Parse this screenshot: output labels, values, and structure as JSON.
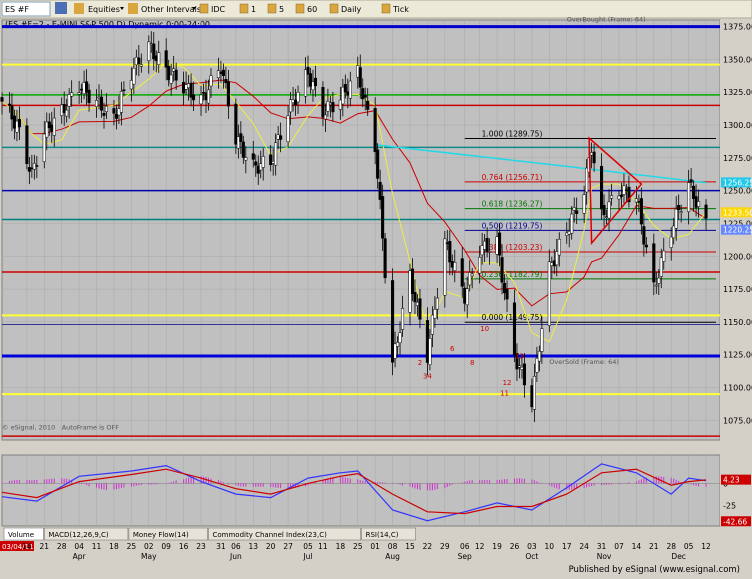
{
  "toolbar": {
    "symbol_box": "ES #F",
    "equities_label": "Equities",
    "other_intervals_label": "Other Intervals",
    "intervals": [
      "IDC",
      "1",
      "5",
      "60",
      "Daily",
      "Tick"
    ]
  },
  "chart_data": [
    {
      "type": "candlestick",
      "title": "(ES #F=2 - E-MINI S&P 500,D) Dynamic 0:00-24:00",
      "ylim": [
        1060,
        1380
      ],
      "yticks": [
        1075,
        1100,
        1125,
        1150,
        1175,
        1200,
        1225,
        1250,
        1275,
        1300,
        1325,
        1350,
        1375
      ],
      "last_price_labels": [
        {
          "text": "1256.25",
          "value": 1256.25,
          "color": "#22c8e8"
        },
        {
          "text": "1233.50",
          "value": 1233.5,
          "color": "#ffd700"
        },
        {
          "text": "1220.25",
          "value": 1220.25,
          "color": "#6688ff"
        }
      ],
      "x_dates": [
        {
          "date": "2011-03-14",
          "label": "14"
        },
        {
          "date": "2011-03-21",
          "label": "21"
        },
        {
          "date": "2011-03-28",
          "label": "28"
        },
        {
          "date": "2011-04-04",
          "label": "04"
        },
        {
          "date": "2011-04-11",
          "label": "11"
        },
        {
          "date": "2011-04-18",
          "label": "18"
        },
        {
          "date": "2011-04-25",
          "label": "25"
        },
        {
          "date": "2011-05-02",
          "label": "02"
        },
        {
          "date": "2011-05-09",
          "label": "09"
        },
        {
          "date": "2011-05-16",
          "label": "16"
        },
        {
          "date": "2011-05-23",
          "label": "23"
        },
        {
          "date": "2011-05-31",
          "label": "31"
        },
        {
          "date": "2011-06-06",
          "label": "06"
        },
        {
          "date": "2011-06-13",
          "label": "13"
        },
        {
          "date": "2011-06-20",
          "label": "20"
        },
        {
          "date": "2011-06-27",
          "label": "27"
        },
        {
          "date": "2011-07-05",
          "label": "05"
        },
        {
          "date": "2011-07-11",
          "label": "11"
        },
        {
          "date": "2011-07-18",
          "label": "18"
        },
        {
          "date": "2011-07-25",
          "label": "25"
        },
        {
          "date": "2011-08-01",
          "label": "01"
        },
        {
          "date": "2011-08-08",
          "label": "08"
        },
        {
          "date": "2011-08-15",
          "label": "15"
        },
        {
          "date": "2011-08-22",
          "label": "22"
        },
        {
          "date": "2011-08-29",
          "label": "29"
        },
        {
          "date": "2011-09-06",
          "label": "06"
        },
        {
          "date": "2011-09-12",
          "label": "12"
        },
        {
          "date": "2011-09-19",
          "label": "19"
        },
        {
          "date": "2011-09-26",
          "label": "26"
        },
        {
          "date": "2011-10-03",
          "label": "03"
        },
        {
          "date": "2011-10-10",
          "label": "10"
        },
        {
          "date": "2011-10-17",
          "label": "17"
        },
        {
          "date": "2011-10-24",
          "label": "24"
        },
        {
          "date": "2011-10-31",
          "label": "31"
        },
        {
          "date": "2011-11-07",
          "label": "07"
        },
        {
          "date": "2011-11-14",
          "label": "14"
        },
        {
          "date": "2011-11-21",
          "label": "21"
        },
        {
          "date": "2011-11-28",
          "label": "28"
        },
        {
          "date": "2011-12-05",
          "label": "05"
        },
        {
          "date": "2011-12-12",
          "label": "12"
        }
      ],
      "first_date_label": "03/04/11",
      "month_labels": [
        {
          "date": "2011-04-04",
          "label": "Apr"
        },
        {
          "date": "2011-05-02",
          "label": "May"
        },
        {
          "date": "2011-06-06",
          "label": "Jun"
        },
        {
          "date": "2011-07-05",
          "label": "Jul"
        },
        {
          "date": "2011-08-08",
          "label": "Aug"
        },
        {
          "date": "2011-09-06",
          "label": "Sep"
        },
        {
          "date": "2011-10-03",
          "label": "Oct"
        },
        {
          "date": "2011-11-01",
          "label": "Nov"
        },
        {
          "date": "2011-12-01",
          "label": "Dec"
        }
      ],
      "close_path": [
        {
          "date": "2011-03-04",
          "value": 1318
        },
        {
          "date": "2011-03-10",
          "value": 1300
        },
        {
          "date": "2011-03-16",
          "value": 1262
        },
        {
          "date": "2011-03-21",
          "value": 1294
        },
        {
          "date": "2011-03-28",
          "value": 1310
        },
        {
          "date": "2011-04-04",
          "value": 1330
        },
        {
          "date": "2011-04-18",
          "value": 1305
        },
        {
          "date": "2011-04-25",
          "value": 1340
        },
        {
          "date": "2011-05-02",
          "value": 1360
        },
        {
          "date": "2011-05-09",
          "value": 1342
        },
        {
          "date": "2011-05-16",
          "value": 1330
        },
        {
          "date": "2011-05-23",
          "value": 1318
        },
        {
          "date": "2011-05-31",
          "value": 1345
        },
        {
          "date": "2011-06-06",
          "value": 1290
        },
        {
          "date": "2011-06-13",
          "value": 1268
        },
        {
          "date": "2011-06-20",
          "value": 1272
        },
        {
          "date": "2011-06-27",
          "value": 1310
        },
        {
          "date": "2011-07-05",
          "value": 1340
        },
        {
          "date": "2011-07-11",
          "value": 1310
        },
        {
          "date": "2011-07-18",
          "value": 1320
        },
        {
          "date": "2011-07-25",
          "value": 1340
        },
        {
          "date": "2011-08-01",
          "value": 1285
        },
        {
          "date": "2011-08-08",
          "value": 1118
        },
        {
          "date": "2011-08-15",
          "value": 1185
        },
        {
          "date": "2011-08-22",
          "value": 1125
        },
        {
          "date": "2011-08-29",
          "value": 1210
        },
        {
          "date": "2011-09-06",
          "value": 1170
        },
        {
          "date": "2011-09-12",
          "value": 1205
        },
        {
          "date": "2011-09-19",
          "value": 1210
        },
        {
          "date": "2011-09-26",
          "value": 1125
        },
        {
          "date": "2011-10-03",
          "value": 1090
        },
        {
          "date": "2011-10-10",
          "value": 1190
        },
        {
          "date": "2011-10-17",
          "value": 1220
        },
        {
          "date": "2011-10-24",
          "value": 1250
        },
        {
          "date": "2011-10-27",
          "value": 1285
        },
        {
          "date": "2011-10-31",
          "value": 1230
        },
        {
          "date": "2011-11-07",
          "value": 1250
        },
        {
          "date": "2011-11-14",
          "value": 1245
        },
        {
          "date": "2011-11-21",
          "value": 1175
        },
        {
          "date": "2011-11-28",
          "value": 1220
        },
        {
          "date": "2011-12-05",
          "value": 1255
        },
        {
          "date": "2011-12-12",
          "value": 1225
        }
      ],
      "horizontal_lines": [
        {
          "value": 1375,
          "color": "#0000cc",
          "width": 3
        },
        {
          "value": 1346,
          "color": "#ffff33",
          "width": 2
        },
        {
          "value": 1323,
          "color": "#00aa00",
          "width": 1.5
        },
        {
          "value": 1315,
          "color": "#cc0000",
          "width": 1.5
        },
        {
          "value": 1283,
          "color": "#118888",
          "width": 1.5
        },
        {
          "value": 1250,
          "color": "#0000aa",
          "width": 1.5
        },
        {
          "value": 1228,
          "color": "#008080",
          "width": 1.5
        },
        {
          "value": 1188,
          "color": "#cc0000",
          "width": 1.5
        },
        {
          "value": 1155,
          "color": "#ffff33",
          "width": 2
        },
        {
          "value": 1148,
          "color": "#333399",
          "width": 1
        },
        {
          "value": 1124,
          "color": "#0000dd",
          "width": 3
        },
        {
          "value": 1095,
          "color": "#ffff33",
          "width": 2
        },
        {
          "value": 1063,
          "color": "#cc0000",
          "width": 1.5
        }
      ],
      "fib_levels": [
        {
          "label": "1.000 (1289.75)",
          "value": 1289.75,
          "color": "#000000"
        },
        {
          "label": "0.764 (1256.71)",
          "value": 1256.71,
          "color": "#cc0000"
        },
        {
          "label": "0.618 (1236.27)",
          "value": 1236.27,
          "color": "#007700"
        },
        {
          "label": "0.500 (1219.75)",
          "value": 1219.75,
          "color": "#000099"
        },
        {
          "label": "0.382 (1203.23)",
          "value": 1203.23,
          "color": "#cc0000"
        },
        {
          "label": "0.236 (1182.79)",
          "value": 1182.79,
          "color": "#007700"
        },
        {
          "label": "0.000 (1149.75)",
          "value": 1149.75,
          "color": "#000000"
        }
      ],
      "annotations": [
        {
          "text": "OverBought (Frame: 64)",
          "date": "2011-10-17",
          "value": 1379
        },
        {
          "text": "OverSold (Frame: 64)",
          "date": "2011-10-10",
          "value": 1118
        },
        {
          "text": "© eSignal, 2010",
          "date": "2011-03-04",
          "value": 1068
        },
        {
          "text": "AutoFrame is OFF",
          "date": "2011-03-28",
          "value": 1068
        }
      ],
      "count_labels": [
        {
          "text": "34",
          "date": "2011-08-22",
          "value": 1107,
          "color": "#cc0000"
        },
        {
          "text": "2",
          "date": "2011-08-19",
          "value": 1117,
          "color": "#cc0000"
        },
        {
          "text": "8",
          "date": "2011-09-09",
          "value": 1117,
          "color": "#cc0000"
        },
        {
          "text": "6",
          "date": "2011-09-01",
          "value": 1128,
          "color": "#cc0000"
        },
        {
          "text": "10",
          "date": "2011-09-14",
          "value": 1143,
          "color": "#cc0000"
        },
        {
          "text": "12",
          "date": "2011-09-23",
          "value": 1102,
          "color": "#cc0000"
        },
        {
          "text": "11",
          "date": "2011-09-22",
          "value": 1094,
          "color": "#cc0000"
        },
        {
          "text": "13",
          "date": "2011-09-28",
          "value": 1122,
          "color": "#cc0000"
        }
      ]
    },
    {
      "type": "line",
      "title": "",
      "ylim": [
        -48,
        32
      ],
      "yticks": [
        0,
        -25
      ],
      "value_labels": [
        {
          "text": "4.23",
          "value": 4.23,
          "color": "#cc0000"
        },
        {
          "text": "-42.66",
          "value": -42.66,
          "color": "#cc0000"
        }
      ],
      "series": [
        {
          "color": "#3333ff",
          "values": [
            {
              "date": "2011-03-04",
              "value": -15
            },
            {
              "date": "2011-03-18",
              "value": -20
            },
            {
              "date": "2011-04-04",
              "value": 8
            },
            {
              "date": "2011-04-25",
              "value": 14
            },
            {
              "date": "2011-05-09",
              "value": 20
            },
            {
              "date": "2011-05-23",
              "value": 2
            },
            {
              "date": "2011-06-06",
              "value": -12
            },
            {
              "date": "2011-06-20",
              "value": -16
            },
            {
              "date": "2011-07-05",
              "value": 6
            },
            {
              "date": "2011-07-18",
              "value": 12
            },
            {
              "date": "2011-07-25",
              "value": 14
            },
            {
              "date": "2011-08-08",
              "value": -30
            },
            {
              "date": "2011-08-22",
              "value": -42
            },
            {
              "date": "2011-09-06",
              "value": -32
            },
            {
              "date": "2011-09-19",
              "value": -22
            },
            {
              "date": "2011-10-03",
              "value": -30
            },
            {
              "date": "2011-10-17",
              "value": -5
            },
            {
              "date": "2011-10-31",
              "value": 22
            },
            {
              "date": "2011-11-14",
              "value": 12
            },
            {
              "date": "2011-11-28",
              "value": -12
            },
            {
              "date": "2011-12-05",
              "value": 6
            },
            {
              "date": "2011-12-12",
              "value": 3
            }
          ]
        },
        {
          "color": "#cc0000",
          "values": [
            {
              "date": "2011-03-04",
              "value": -10
            },
            {
              "date": "2011-03-18",
              "value": -16
            },
            {
              "date": "2011-04-04",
              "value": 2
            },
            {
              "date": "2011-04-25",
              "value": 10
            },
            {
              "date": "2011-05-09",
              "value": 16
            },
            {
              "date": "2011-05-23",
              "value": 6
            },
            {
              "date": "2011-06-06",
              "value": -6
            },
            {
              "date": "2011-06-20",
              "value": -12
            },
            {
              "date": "2011-07-05",
              "value": 0
            },
            {
              "date": "2011-07-18",
              "value": 8
            },
            {
              "date": "2011-07-25",
              "value": 11
            },
            {
              "date": "2011-08-08",
              "value": -12
            },
            {
              "date": "2011-08-22",
              "value": -32
            },
            {
              "date": "2011-09-06",
              "value": -34
            },
            {
              "date": "2011-09-19",
              "value": -26
            },
            {
              "date": "2011-10-03",
              "value": -26
            },
            {
              "date": "2011-10-17",
              "value": -12
            },
            {
              "date": "2011-10-31",
              "value": 12
            },
            {
              "date": "2011-11-14",
              "value": 16
            },
            {
              "date": "2011-11-28",
              "value": -2
            },
            {
              "date": "2011-12-05",
              "value": 2
            },
            {
              "date": "2011-12-12",
              "value": 4
            }
          ]
        }
      ]
    }
  ],
  "tabs": [
    "Volume",
    "MACD(12,26,9,C)",
    "Money Flow(14)",
    "Commodity Channel Index(23,C)",
    "RSI(14,C)"
  ],
  "footer": "Published by eSignal (www.esignal.com)"
}
